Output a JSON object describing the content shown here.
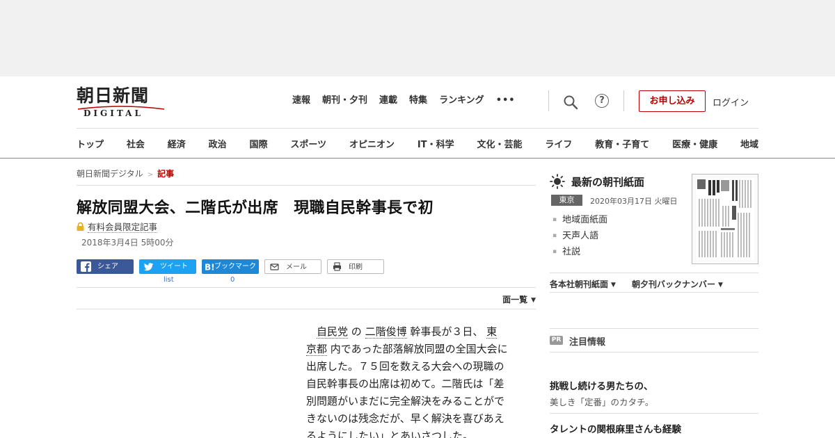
{
  "logo": {
    "main": "朝日新聞",
    "sub": "DIGITAL"
  },
  "topnav": {
    "items": [
      "速報",
      "朝刊・夕刊",
      "連載",
      "特集",
      "ランキング"
    ],
    "more": "•••",
    "apply_label": "お申し込み",
    "login_label": "ログイン",
    "help_glyph": "?"
  },
  "categories": [
    "トップ",
    "社会",
    "経済",
    "政治",
    "国際",
    "スポーツ",
    "オピニオン",
    "IT・科学",
    "文化・芸能",
    "ライフ",
    "教育・子育て",
    "医療・健康",
    "地域"
  ],
  "breadcrumb": {
    "home": "朝日新聞デジタル",
    "sep": ">",
    "current": "記事"
  },
  "article": {
    "title": "解放同盟大会、二階氏が出席　現職自民幹事長で初",
    "member_label": "有料会員限定記事",
    "date": "2018年3月4日 5時00分",
    "share": {
      "facebook": "シェア",
      "twitter": "ツイート",
      "twitter_count": "list",
      "hatena": "ブックマーク",
      "hatena_count": "0",
      "mail": "メール",
      "print": "印刷"
    },
    "page_list": "面一覧",
    "body": {
      "l1a": "自民党",
      "l1b": " の ",
      "l1c": "二階俊博",
      "l1d": " 幹事長が３日、 ",
      "l1e": "東",
      "l2a": "京都",
      "l2b": " 内であった部落解放同盟の全国大会に",
      "l3": "出席した。７５回を数える大会への現職の",
      "l4": "自民幹事長の出席は初めて。二階氏は「差",
      "l5": "別問題がいまだに完全解決をみることがで",
      "l6": "きないのは残念だが、早く解決を喜びあえ",
      "l7": "るようにしたい」とあいさつした。"
    }
  },
  "sidebar": {
    "title": "最新の朝刊紙面",
    "region": "東京",
    "paper_date": "2020年03月17日 火曜日",
    "links": [
      "地域面紙面",
      "天声人語",
      "社説"
    ],
    "dropdown1": "各本社朝刊紙面",
    "dropdown2": "朝夕刊バックナンバー",
    "caret": "▼",
    "pr_tag": "PR",
    "pr_label": "注目情報",
    "promo1_head": "挑戦し続ける男たちの、",
    "promo1_sub": "美しき「定番」のカタチ。",
    "promo2_head": "タレントの関根麻里さんも経験"
  },
  "colors": {
    "brand_red": "#bb0000",
    "facebook": "#3b5998",
    "twitter": "#1da1f2",
    "hatena": "#1e88d6"
  }
}
